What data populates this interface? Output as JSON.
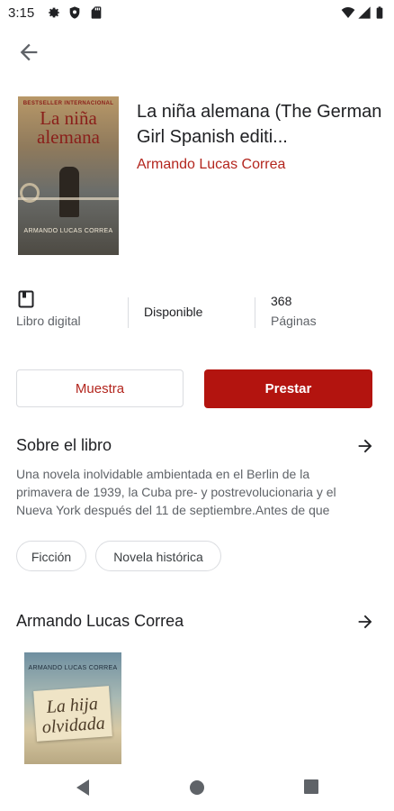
{
  "status": {
    "time": "3:15"
  },
  "book": {
    "title": "La niña alemana (The German Girl Spanish editi...",
    "author": "Armando Lucas Correa",
    "cover": {
      "top_text": "BESTSELLER INTERNACIONAL",
      "title": "La niña alemana",
      "author": "ARMANDO LUCAS CORREA"
    }
  },
  "meta": {
    "format_label": "Libro digital",
    "availability": "Disponible",
    "pages_value": "368",
    "pages_label": "Páginas"
  },
  "actions": {
    "sample_label": "Muestra",
    "borrow_label": "Prestar"
  },
  "about": {
    "title": "Sobre el libro",
    "text": "Una novela inolvidable ambientada en el Berlin de la primavera de 1939, la Cuba pre- y postrevolucionaria y el Nueva York después del 11 de septiembre.Antes de que"
  },
  "genres": [
    "Ficción",
    "Novela histórica"
  ],
  "more_by_author": {
    "title": "Armando Lucas Correa",
    "books": [
      {
        "author": "ARMANDO LUCAS CORREA",
        "title": "La hija olvidada"
      }
    ]
  },
  "colors": {
    "accent": "#b3140f",
    "author_red": "#b3261e"
  }
}
